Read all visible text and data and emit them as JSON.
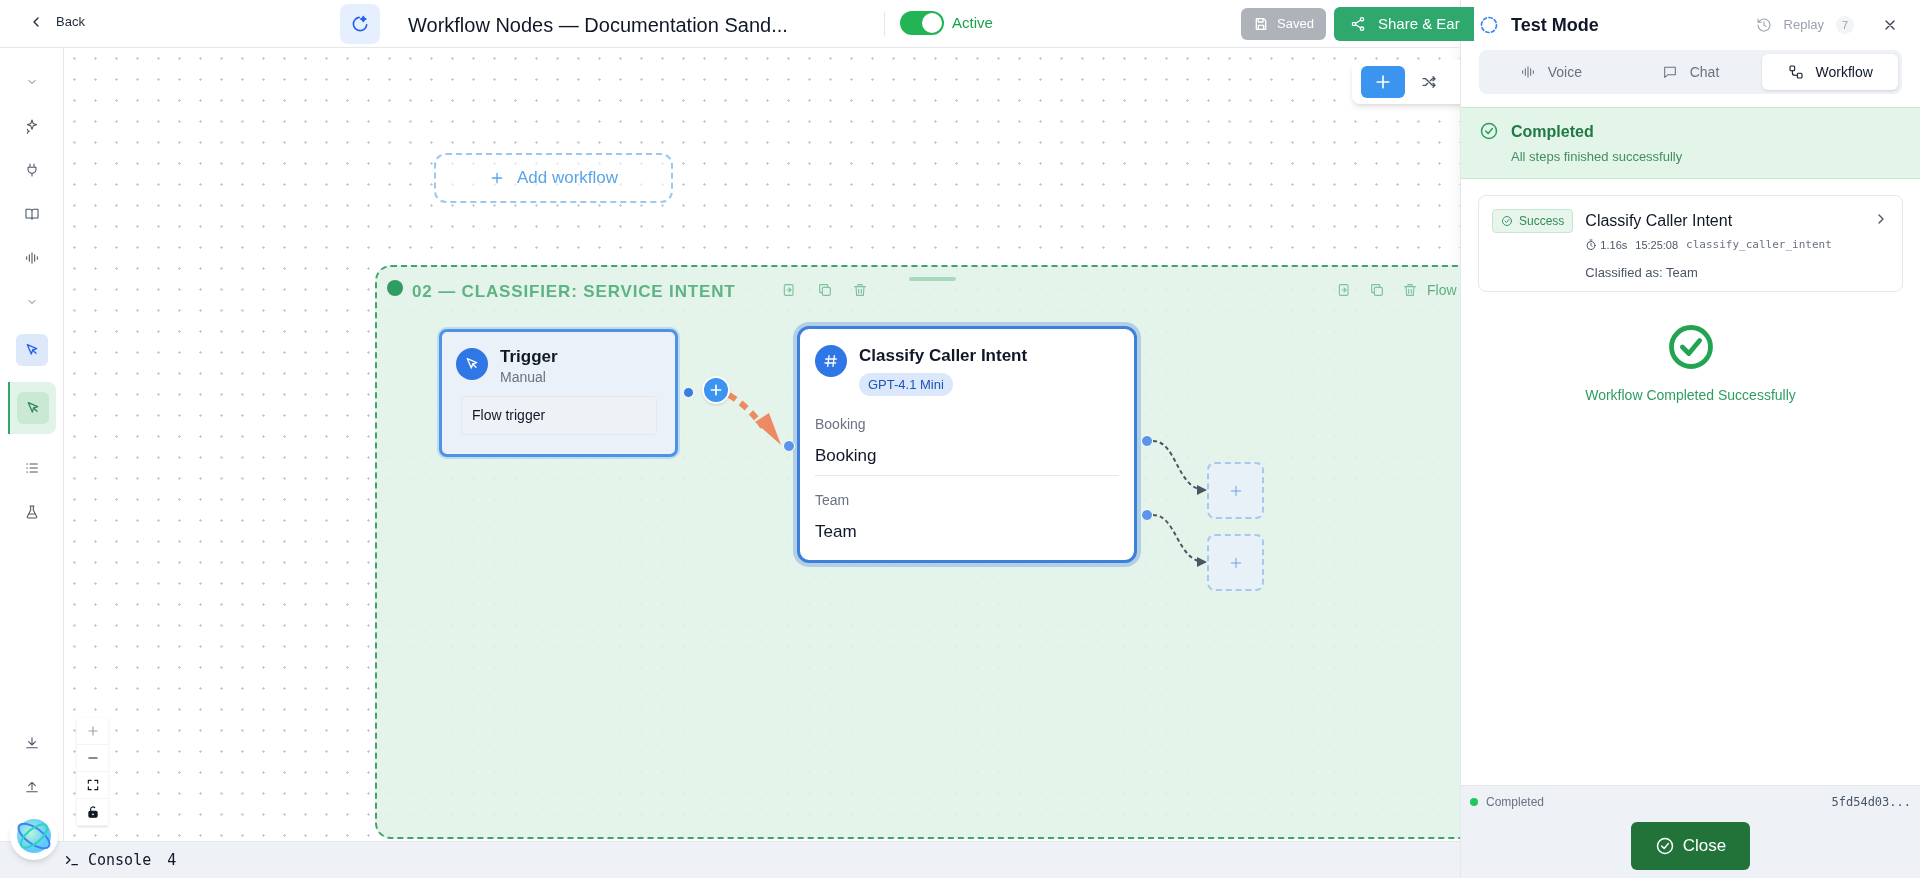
{
  "header": {
    "back": "Back",
    "title": "Workflow Nodes — Documentation Sand...",
    "toggle": {
      "label": "Active",
      "on": true
    },
    "buttons": [
      {
        "kind": "saved",
        "label": "Saved"
      },
      {
        "kind": "share",
        "label": "Share & Ear"
      }
    ]
  },
  "sidebar": {
    "items": [
      {
        "kind": "chevron"
      },
      {
        "kind": "icon",
        "selected": false
      },
      {
        "kind": "icon",
        "selected": false
      },
      {
        "kind": "icon",
        "selected": false
      },
      {
        "kind": "icon",
        "selected": false
      },
      {
        "kind": "chevron"
      },
      {
        "kind": "mode"
      },
      {
        "kind": "icon",
        "selected": true
      },
      {
        "kind": "icon",
        "selected": false
      },
      {
        "kind": "icon",
        "selected": false
      }
    ],
    "bottom_items": [
      {
        "kind": "icon",
        "selected": false
      },
      {
        "kind": "icon",
        "selected": false
      }
    ]
  },
  "canvas": {
    "add_workflow": "Add workflow",
    "group": {
      "title": "02 — CLASSIFIER: SERVICE INTENT",
      "side_label": "Flow",
      "nodes": [
        {
          "kind": "trigger",
          "title": "Trigger",
          "subtitle": "Manual",
          "body": "Flow trigger"
        },
        {
          "kind": "classifier",
          "title": "Classify Caller Intent",
          "badge": "GPT-4.1 Mini",
          "routes": [
            {
              "label": "Booking",
              "value": "Booking"
            },
            {
              "label": "Team",
              "value": "Team"
            }
          ]
        }
      ]
    }
  },
  "console": {
    "label": "Console",
    "count": "4"
  },
  "test_panel": {
    "title": "Test Mode",
    "replay": {
      "label": "Replay",
      "count": "7",
      "disabled": true
    },
    "tabs": [
      {
        "label": "Voice",
        "selected": false
      },
      {
        "label": "Chat",
        "selected": false
      },
      {
        "label": "Workflow",
        "selected": true
      }
    ],
    "banner": {
      "title": "Completed",
      "subtitle": "All steps finished successfully"
    },
    "steps": [
      {
        "status": "Success",
        "title": "Classify Caller Intent",
        "duration": "1.16s",
        "time": "15:25:08",
        "id": "classify_caller_intent",
        "result": "Classified as: Team"
      }
    ],
    "result": "Workflow Completed Successfully",
    "footer": {
      "status": "Completed",
      "run_id": "5fd54d03..."
    },
    "close": "Close"
  }
}
